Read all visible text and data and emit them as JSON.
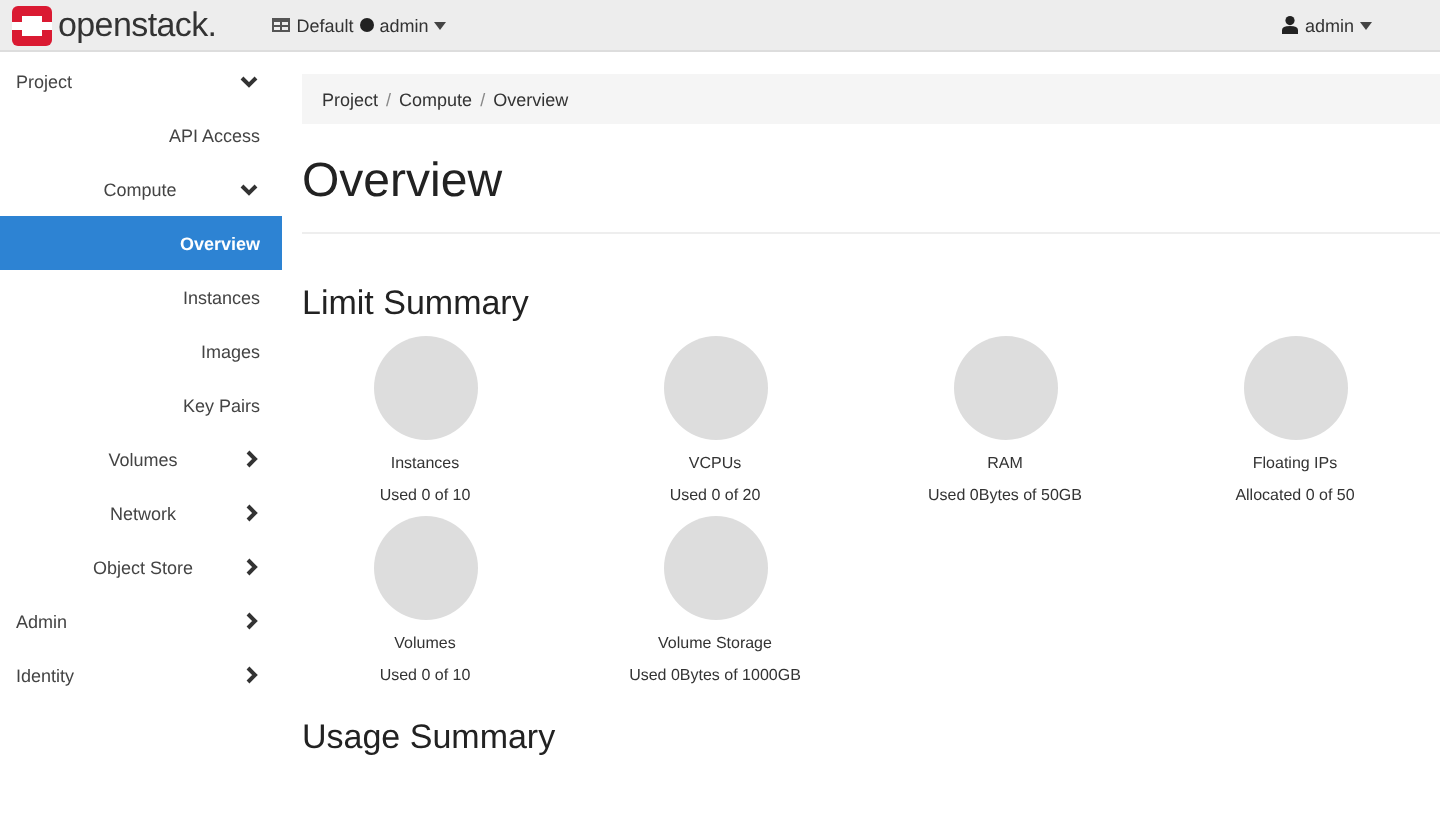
{
  "top_bar": {
    "logo": "openstack.",
    "project_selector": {
      "domain": "Default",
      "project": "admin"
    },
    "user_menu": "admin"
  },
  "sidebar": {
    "items": [
      {
        "kind": "group",
        "label": "Project",
        "expanded": true,
        "children": [
          {
            "kind": "link",
            "label": "API Access",
            "selected": false
          },
          {
            "kind": "group",
            "label": "Compute",
            "expanded": true,
            "children": [
              {
                "kind": "link",
                "label": "Overview",
                "selected": true
              },
              {
                "kind": "link",
                "label": "Instances",
                "selected": false
              },
              {
                "kind": "link",
                "label": "Images",
                "selected": false
              },
              {
                "kind": "link",
                "label": "Key Pairs",
                "selected": false
              }
            ]
          },
          {
            "kind": "group",
            "label": "Volumes",
            "expanded": false
          },
          {
            "kind": "group",
            "label": "Network",
            "expanded": false
          },
          {
            "kind": "group",
            "label": "Object Store",
            "expanded": false
          }
        ]
      },
      {
        "kind": "group",
        "label": "Admin",
        "expanded": false
      },
      {
        "kind": "group",
        "label": "Identity",
        "expanded": false
      }
    ]
  },
  "breadcrumb": {
    "separator": "/",
    "items": [
      "Project",
      "Compute",
      "Overview"
    ]
  },
  "page_title": "Overview",
  "limit_summary": {
    "title": "Limit Summary",
    "charts": [
      {
        "label": "Instances",
        "reading": "Used 0 of 10"
      },
      {
        "label": "VCPUs",
        "reading": "Used 0 of 20"
      },
      {
        "label": "RAM",
        "reading": "Used 0Bytes of 50GB"
      },
      {
        "label": "Floating IPs",
        "reading": "Allocated 0 of 50"
      },
      {
        "label": "Volumes",
        "reading": "Used 0 of 10"
      },
      {
        "label": "Volume Storage",
        "reading": "Used 0Bytes of 1000GB"
      }
    ]
  },
  "usage_summary": {
    "title": "Usage Summary"
  }
}
